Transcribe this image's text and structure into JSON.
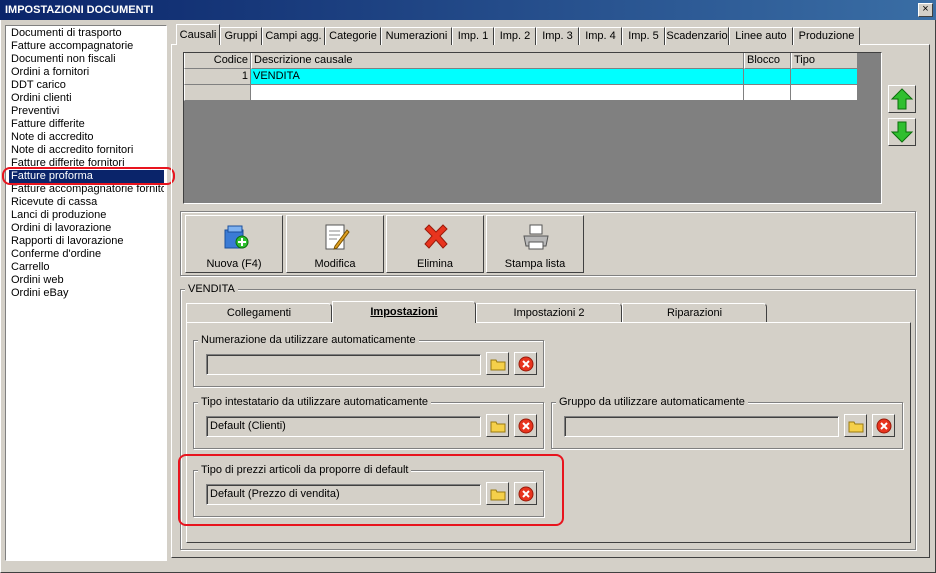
{
  "window": {
    "title": "IMPOSTAZIONI DOCUMENTI",
    "close_label": "×"
  },
  "doc_list": {
    "items": [
      "Documenti di trasporto",
      "Fatture accompagnatorie",
      "Documenti non fiscali",
      "Ordini a fornitori",
      "DDT carico",
      "Ordini clienti",
      "Preventivi",
      "Fatture differite",
      "Note di accredito",
      "Note di accredito fornitori",
      "Fatture differite fornitori",
      "Fatture proforma",
      "Fatture accompagnatorie fornitori",
      "Ricevute di cassa",
      "Lanci di produzione",
      "Ordini di lavorazione",
      "Rapporti di lavorazione",
      "Conferme d'ordine",
      "Carrello",
      "Ordini web",
      "Ordini eBay"
    ],
    "selected_index": 11
  },
  "tabs": [
    "Causali",
    "Gruppi",
    "Campi agg.",
    "Categorie",
    "Numerazioni",
    "Imp. 1",
    "Imp. 2",
    "Imp. 3",
    "Imp. 4",
    "Imp. 5",
    "Scadenzario",
    "Linee auto",
    "Produzione"
  ],
  "grid": {
    "headers": {
      "codice": "Codice",
      "descrizione": "Descrizione causale",
      "blocco": "Blocco",
      "tipo": "Tipo"
    },
    "row1": {
      "codice": "1",
      "descrizione": "VENDITA"
    }
  },
  "toolbar": {
    "new_label": "Nuova (F4)",
    "edit_label": "Modifica",
    "delete_label": "Elimina",
    "print_label": "Stampa lista"
  },
  "detail": {
    "group_title": "VENDITA",
    "subtabs": [
      "Collegamenti",
      "Impostazioni",
      "Impostazioni 2",
      "Riparazioni"
    ],
    "numerazione": {
      "label": "Numerazione da utilizzare automaticamente",
      "value": ""
    },
    "tipo_intestatario": {
      "label": "Tipo intestatario da utilizzare automaticamente",
      "value": "Default (Clienti)"
    },
    "gruppo": {
      "label": "Gruppo da utilizzare automaticamente",
      "value": ""
    },
    "tipo_prezzi": {
      "label": "Tipo di prezzi articoli da proporre di default",
      "value": "Default (Prezzo di vendita)"
    }
  },
  "colors": {
    "selection": "#0a246a",
    "grid_row": "#00ffff",
    "highlight": "#e8141e"
  }
}
